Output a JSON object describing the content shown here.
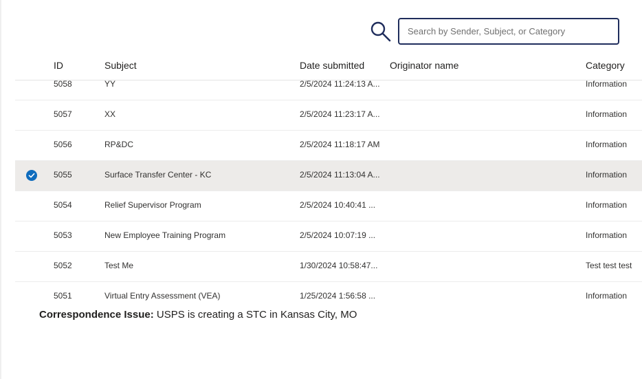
{
  "search": {
    "placeholder": "Search by Sender, Subject, or Category",
    "value": ""
  },
  "table": {
    "headers": {
      "id": "ID",
      "subject": "Subject",
      "date": "Date submitted",
      "originator": "Originator name",
      "category": "Category"
    },
    "rows": [
      {
        "id": "5058",
        "subject": "YY",
        "date": "2/5/2024 11:24:13 A...",
        "originator": "",
        "category": "Information",
        "selected": false
      },
      {
        "id": "5057",
        "subject": "XX",
        "date": "2/5/2024 11:23:17 A...",
        "originator": "",
        "category": "Information",
        "selected": false
      },
      {
        "id": "5056",
        "subject": "RP&DC",
        "date": "2/5/2024 11:18:17 AM",
        "originator": "",
        "category": "Information",
        "selected": false
      },
      {
        "id": "5055",
        "subject": "Surface Transfer Center - KC",
        "date": "2/5/2024 11:13:04 A...",
        "originator": "",
        "category": "Information",
        "selected": true
      },
      {
        "id": "5054",
        "subject": "Relief Supervisor Program",
        "date": "2/5/2024 10:40:41 ...",
        "originator": "",
        "category": "Information",
        "selected": false
      },
      {
        "id": "5053",
        "subject": "New Employee Training Program",
        "date": "2/5/2024 10:07:19 ...",
        "originator": "",
        "category": "Information",
        "selected": false
      },
      {
        "id": "5052",
        "subject": "Test Me",
        "date": "1/30/2024 10:58:47...",
        "originator": "",
        "category": "Test test test",
        "selected": false
      },
      {
        "id": "5051",
        "subject": "Virtual Entry Assessment (VEA)",
        "date": "1/25/2024 1:56:58 ...",
        "originator": "",
        "category": "Information",
        "selected": false
      }
    ]
  },
  "issue": {
    "label": "Correspondence Issue:",
    "text": " USPS is creating a STC in Kansas City, MO"
  },
  "icons": {
    "search": "search-icon",
    "selected": "checkmark-circle-icon"
  },
  "colors": {
    "accent": "#0f6cbd",
    "search_border": "#1f2d5c",
    "selected_row": "#edebe9"
  }
}
